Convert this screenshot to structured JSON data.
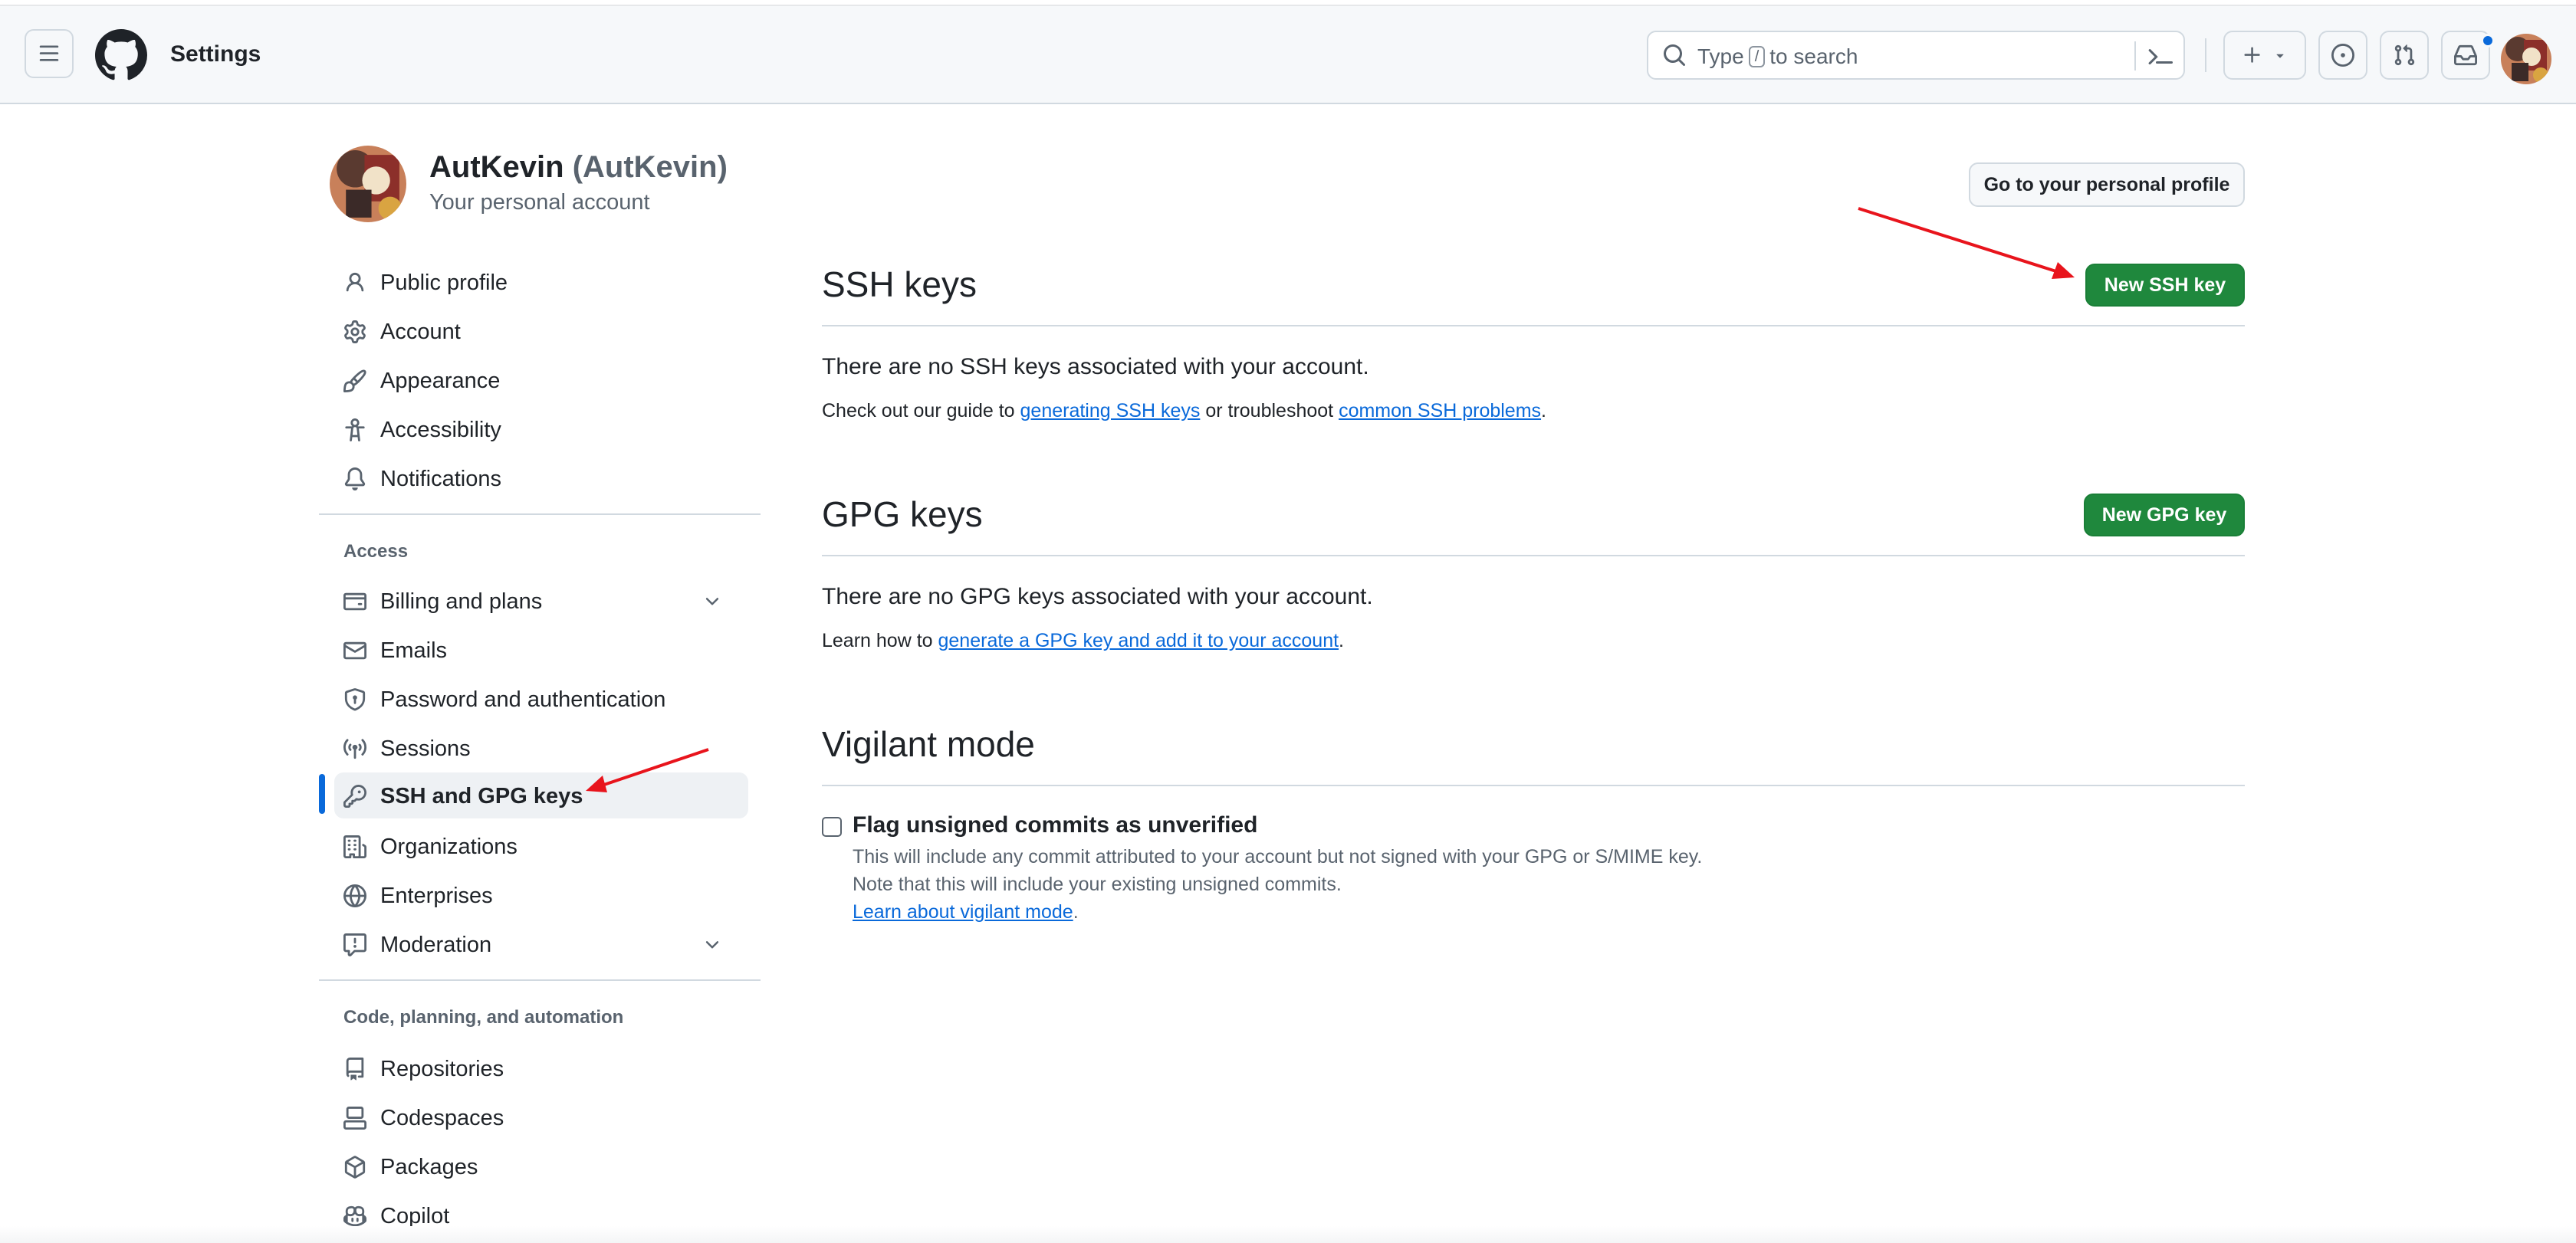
{
  "header": {
    "title": "Settings",
    "search_placeholder_before": "Type",
    "search_key": "/",
    "search_placeholder_after": "to search"
  },
  "user": {
    "name": "AutKevin",
    "handle": "(AutKevin)",
    "subtitle": "Your personal account",
    "profile_button": "Go to your personal profile"
  },
  "sidebar": {
    "items": [
      {
        "label": "Public profile",
        "icon": "person-icon"
      },
      {
        "label": "Account",
        "icon": "gear-icon"
      },
      {
        "label": "Appearance",
        "icon": "paintbrush-icon"
      },
      {
        "label": "Accessibility",
        "icon": "accessibility-icon"
      },
      {
        "label": "Notifications",
        "icon": "bell-icon"
      }
    ],
    "access_heading": "Access",
    "access_items": [
      {
        "label": "Billing and plans",
        "icon": "credit-card-icon"
      },
      {
        "label": "Emails",
        "icon": "mail-icon"
      },
      {
        "label": "Password and authentication",
        "icon": "shield-lock-icon"
      },
      {
        "label": "Sessions",
        "icon": "broadcast-icon"
      },
      {
        "label": "SSH and GPG keys",
        "icon": "key-icon"
      },
      {
        "label": "Organizations",
        "icon": "organization-icon"
      },
      {
        "label": "Enterprises",
        "icon": "globe-icon"
      },
      {
        "label": "Moderation",
        "icon": "report-icon"
      }
    ],
    "code_heading": "Code, planning, and automation",
    "code_items": [
      {
        "label": "Repositories",
        "icon": "repo-icon"
      },
      {
        "label": "Codespaces",
        "icon": "codespaces-icon"
      },
      {
        "label": "Packages",
        "icon": "package-icon"
      },
      {
        "label": "Copilot",
        "icon": "copilot-icon"
      }
    ]
  },
  "ssh": {
    "title": "SSH keys",
    "button": "New SSH key",
    "empty": "There are no SSH keys associated with your account.",
    "guide_before": "Check out our guide to",
    "guide_link": "generating SSH keys",
    "guide_middle": "or troubleshoot",
    "guide_link2": "common SSH problems",
    "guide_after": "."
  },
  "gpg": {
    "title": "GPG keys",
    "button": "New GPG key",
    "empty": "There are no GPG keys associated with your account.",
    "learn_before": "Learn how to",
    "learn_link": "generate a GPG key and add it to your account",
    "learn_after": "."
  },
  "vigilant": {
    "title": "Vigilant mode",
    "checkbox_label": "Flag unsigned commits as unverified",
    "checked": false,
    "note1": "This will include any commit attributed to your account but not signed with your GPG or S/MIME key.",
    "note2": "Note that this will include your existing unsigned commits.",
    "learn_link": "Learn about vigilant mode",
    "learn_after": "."
  },
  "colors": {
    "accent": "#0969da",
    "primary_button": "#1f883d",
    "annotation_arrow": "#e8141c"
  }
}
